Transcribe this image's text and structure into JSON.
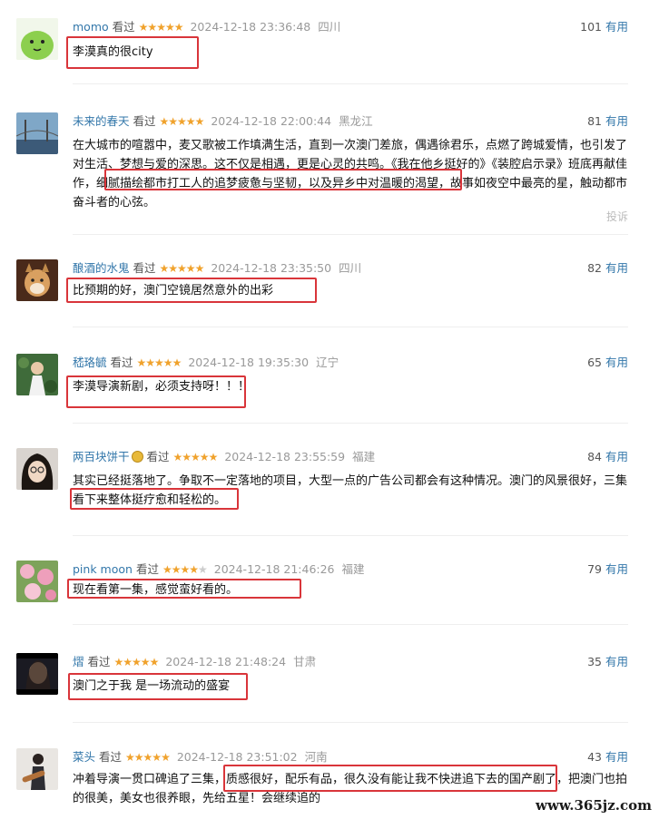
{
  "reviews": [
    {
      "user": "momo",
      "watched": "看过",
      "stars": 5,
      "time": "2024-12-18 23:36:48",
      "location": "四川",
      "useful_count": "101",
      "useful_label": "有用",
      "text": "李漠真的很city"
    },
    {
      "user": "未来的春天",
      "watched": "看过",
      "stars": 5,
      "time": "2024-12-18 22:00:44",
      "location": "黑龙江",
      "useful_count": "81",
      "useful_label": "有用",
      "text": "在大城市的喧嚣中，麦又歌被工作填满生活，直到一次澳门差旅，偶遇徐君乐，点燃了跨城爱情，也引发了对生活、梦想与爱的深思。这不仅是相遇，更是心灵的共鸣。《我在他乡挺好的》《装腔启示录》班底再献佳作，细腻描绘都市打工人的追梦疲惫与坚韧，以及异乡中对温暖的渴望，故事如夜空中最亮的星，触动都市奋斗者的心弦。",
      "report": "投诉"
    },
    {
      "user": "酿酒的水鬼",
      "watched": "看过",
      "stars": 5,
      "time": "2024-12-18 23:35:50",
      "location": "四川",
      "useful_count": "82",
      "useful_label": "有用",
      "text": "比预期的好，澳门空镜居然意外的出彩"
    },
    {
      "user": "嵇珞毓",
      "watched": "看过",
      "stars": 5,
      "time": "2024-12-18 19:35:30",
      "location": "辽宁",
      "useful_count": "65",
      "useful_label": "有用",
      "text": "李漠导演新剧，必须支持呀！！！"
    },
    {
      "user": "两百块饼干",
      "watched": "看过",
      "stars": 5,
      "time": "2024-12-18 23:55:59",
      "location": "福建",
      "useful_count": "84",
      "useful_label": "有用",
      "text": "其实已经挺落地了。争取不一定落地的项目，大型一点的广告公司都会有这种情况。澳门的风景很好，三集看下来整体挺疗愈和轻松的。"
    },
    {
      "user": "pink moon",
      "watched": "看过",
      "stars": 4,
      "time": "2024-12-18 21:46:26",
      "location": "福建",
      "useful_count": "79",
      "useful_label": "有用",
      "text": "现在看第一集，感觉蛮好看的。"
    },
    {
      "user": "熠",
      "watched": "看过",
      "stars": 5,
      "time": "2024-12-18 21:48:24",
      "location": "甘肃",
      "useful_count": "35",
      "useful_label": "有用",
      "text": "澳门之于我 是一场流动的盛宴"
    },
    {
      "user": "菜头",
      "watched": "看过",
      "stars": 5,
      "time": "2024-12-18 23:51:02",
      "location": "河南",
      "useful_count": "43",
      "useful_label": "有用",
      "text": "冲着导演一贯口碑追了三集，质感很好，配乐有品，很久没有能让我不快进追下去的国产剧了，把澳门也拍的很美，美女也很养眼，先给五星！会继续追的"
    }
  ],
  "watermark": "www.365jz.com",
  "colors": {
    "username": "#3377aa",
    "star": "#f0a22c",
    "highlight": "#d9353a",
    "meta": "#999999"
  }
}
